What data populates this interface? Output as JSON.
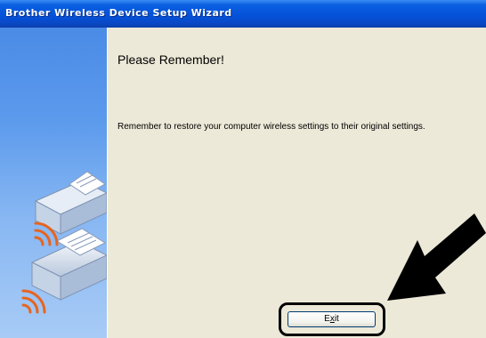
{
  "window": {
    "title": "Brother Wireless Device Setup Wizard"
  },
  "content": {
    "heading": "Please Remember!",
    "message": "Remember to restore your computer wireless settings to their original settings."
  },
  "buttons": {
    "exit_prefix": "E",
    "exit_mnemonic": "x",
    "exit_suffix": "it"
  },
  "icons": {
    "printers": "printer-icon",
    "signal": "wireless-signal-icon",
    "callout": "arrow-icon"
  },
  "colors": {
    "titlebar": "#0451d8",
    "panel": "#ece9d8",
    "sidebar": "#6ea6ee",
    "signal": "#e8641e"
  }
}
